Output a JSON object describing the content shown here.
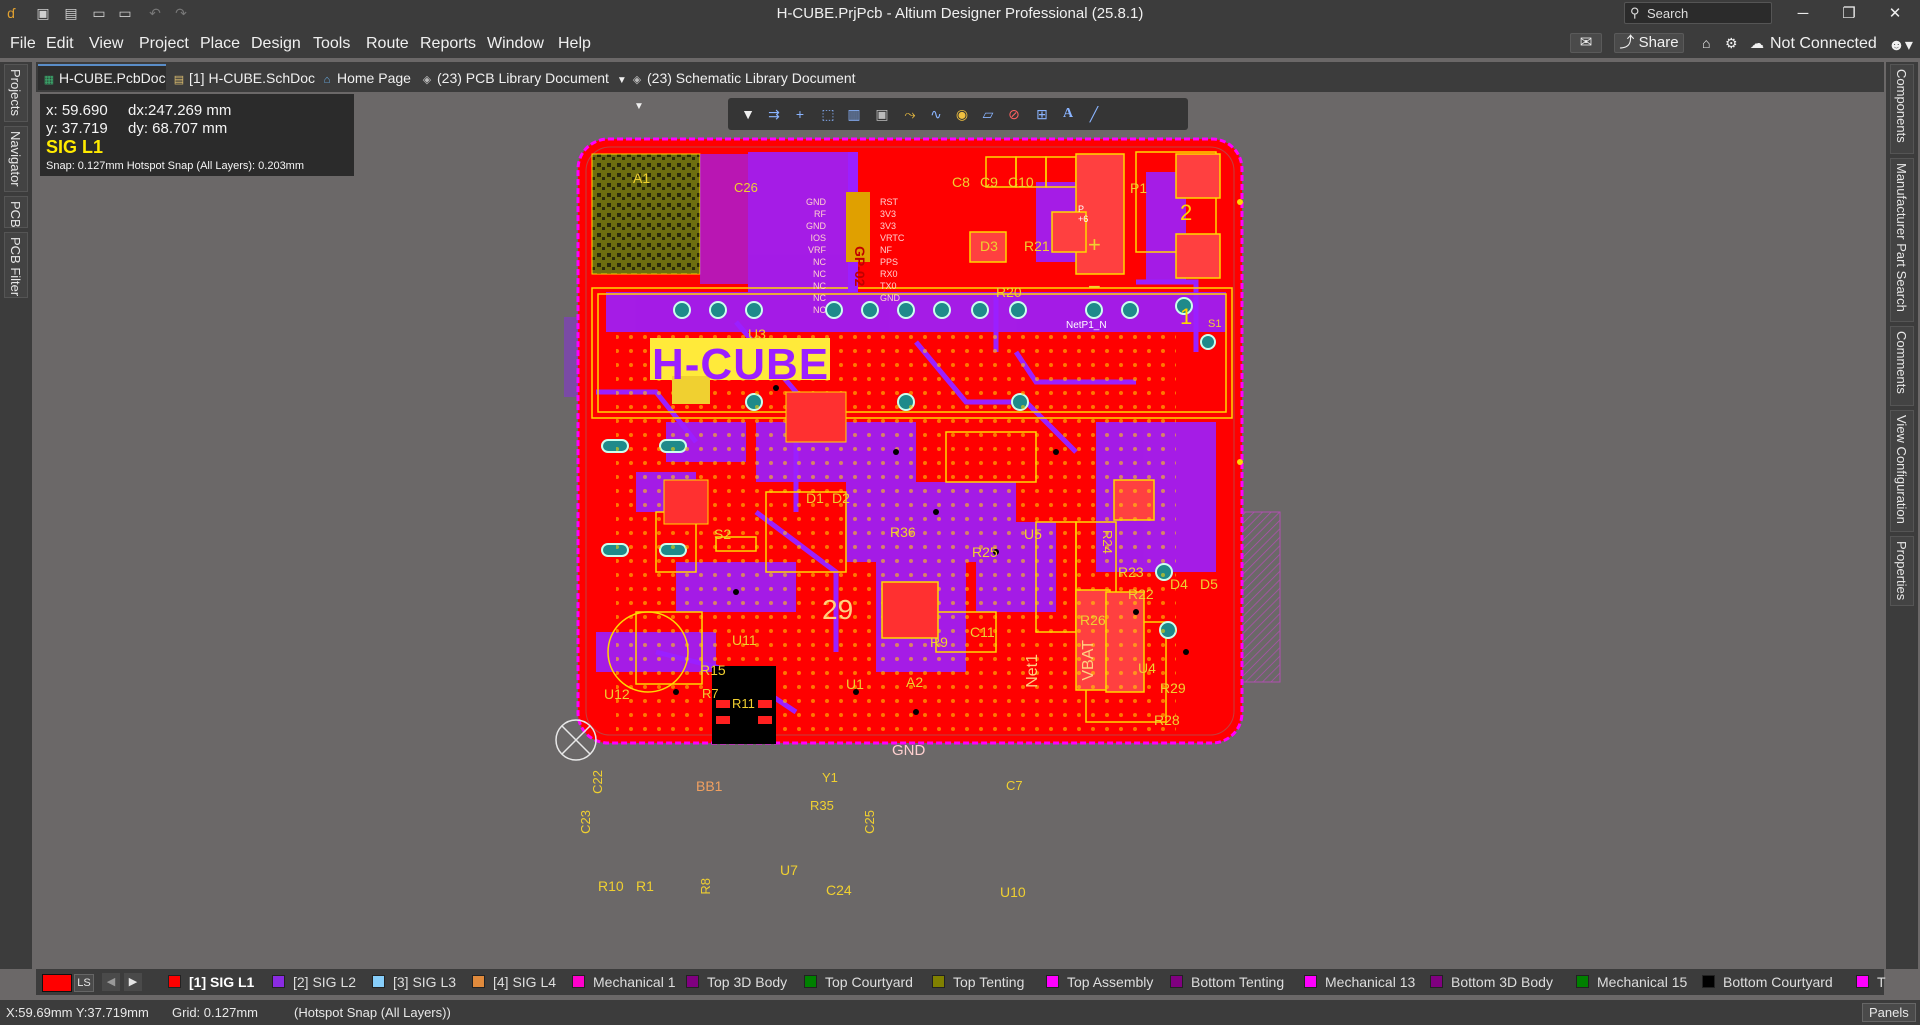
{
  "window": {
    "title": "H-CUBE.PrjPcb - Altium Designer Professional (25.8.1)",
    "search_label": "Search"
  },
  "menu": [
    "File",
    "Edit",
    "View",
    "Project",
    "Place",
    "Design",
    "Tools",
    "Route",
    "Reports",
    "Window",
    "Help"
  ],
  "menu_right": {
    "share": "Share",
    "connection": "Not Connected"
  },
  "tabs": [
    {
      "label": "H-CUBE.PcbDoc",
      "active": true
    },
    {
      "label": "[1] H-CUBE.SchDoc",
      "active": false
    },
    {
      "label": "Home Page",
      "active": false
    },
    {
      "label": "(23) PCB Library Document",
      "active": false
    },
    {
      "label": "(23) Schematic Library Document",
      "active": false
    }
  ],
  "left_panels": [
    "Projects",
    "Navigator",
    "PCB",
    "PCB Filter"
  ],
  "right_panels": [
    "Components",
    "Manufacturer Part Search",
    "Comments",
    "View Configuration",
    "Properties"
  ],
  "coords": {
    "x": "x: 59.690",
    "dx": "dx:247.269 mm",
    "y": "y: 37.719",
    "dy": "dy: 68.707  mm",
    "layer": "SIG L1",
    "snap": "Snap: 0.127mm Hotspot Snap (All Layers): 0.203mm"
  },
  "toolbar_icons": [
    "filter-icon",
    "route-icon",
    "cross-icon",
    "select-rect-icon",
    "chart-icon",
    "component-icon",
    "interactive-route-icon",
    "diff-pair-icon",
    "via-icon",
    "polygon-icon",
    "keepout-icon",
    "dimension-icon",
    "string-icon",
    "line-icon"
  ],
  "board": {
    "title_text": "H-CUBE",
    "labels": {
      "A1": "A1",
      "A2": "A2",
      "P1": "P1",
      "C8": "C8",
      "C9": "C9",
      "C10": "C10",
      "C26": "C26",
      "D3": "D3",
      "R21": "R21",
      "R20": "R20",
      "GP02": "GP-02",
      "num2": "2",
      "num1": "1",
      "plus": "+",
      "minus": "−",
      "U3": "U3",
      "D1": "D1",
      "D2": "D2",
      "S2": "S2",
      "R36": "R36",
      "U5": "U5",
      "R25": "R25",
      "R24": "R24",
      "R23": "R23",
      "R22": "R22",
      "D4": "D4",
      "D5": "D5",
      "R26": "R26",
      "num29": "29",
      "R9": "R9",
      "C11": "C11",
      "U11": "U11",
      "U4": "U4",
      "R29": "R29",
      "R28": "R28",
      "R15": "R15",
      "U12": "U12",
      "R11": "R11",
      "U1": "U1",
      "GND": "GND",
      "Net1": "Net1",
      "VBAT": "VBAT",
      "R7": "R7",
      "C22": "C22",
      "Y1": "Y1",
      "R35": "R35",
      "C7": "C7",
      "C23": "C23",
      "R10": "R10",
      "R1": "R1",
      "R8": "R8",
      "U7": "U7",
      "C24": "C24",
      "U10": "U10",
      "NetP1N": "NetP1_N",
      "P6": "P\n+6",
      "S1": "S1",
      "BB1": "BB1",
      "C25": "C25"
    },
    "pin_labels_left": [
      "GND",
      "RF",
      "GND",
      "IOS",
      "VRF",
      "NC",
      "NC",
      "NC",
      "NC",
      "NC"
    ],
    "pin_labels_right": [
      "RST",
      "3V3",
      "3V3",
      "VRTC",
      "NF",
      "PPS",
      "RX0",
      "TX0",
      "GND"
    ]
  },
  "layer_tabs": [
    {
      "label": "[1] SIG L1",
      "color": "#ff0000",
      "active": true
    },
    {
      "label": "[2] SIG L2",
      "color": "#8a2be2"
    },
    {
      "label": "[3] SIG L3",
      "color": "#87cefa"
    },
    {
      "label": "[4] SIG L4",
      "color": "#e08a3c"
    },
    {
      "label": "Mechanical 1",
      "color": "#ff00cc"
    },
    {
      "label": "Top 3D Body",
      "color": "#800080"
    },
    {
      "label": "Top Courtyard",
      "color": "#008000"
    },
    {
      "label": "Top Tenting",
      "color": "#808000"
    },
    {
      "label": "Top Assembly",
      "color": "#ff00ff"
    },
    {
      "label": "Bottom Tenting",
      "color": "#800080"
    },
    {
      "label": "Mechanical 13",
      "color": "#ff00ff"
    },
    {
      "label": "Bottom 3D Body",
      "color": "#800080"
    },
    {
      "label": "Mechanical 15",
      "color": "#008000"
    },
    {
      "label": "Bottom Courtyard",
      "color": "#000000"
    },
    {
      "label": "T",
      "color": "#ff00ff"
    }
  ],
  "layer_current_label": "LS",
  "status": {
    "xy": "X:59.69mm Y:37.719mm",
    "grid": "Grid: 0.127mm",
    "snap": "(Hotspot Snap (All Layers))",
    "panels": "Panels"
  },
  "colors": {
    "board_red": "#ff0000",
    "trace_purple": "#9b1fff",
    "silk_yellow": "#f0d030",
    "via_teal": "#1f8a8a",
    "workspace": "#6b6868"
  }
}
